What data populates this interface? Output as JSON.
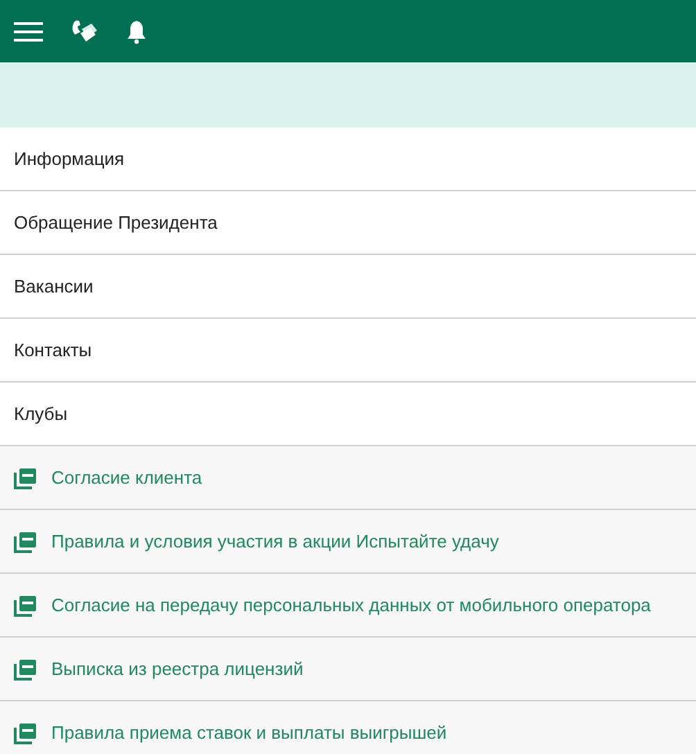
{
  "menu": [
    {
      "kind": "link",
      "label": "Информация"
    },
    {
      "kind": "link",
      "label": "Обращение Президента"
    },
    {
      "kind": "link",
      "label": "Вакансии"
    },
    {
      "kind": "link",
      "label": "Контакты"
    },
    {
      "kind": "link",
      "label": "Клубы"
    },
    {
      "kind": "pdf",
      "label": "Согласие клиента"
    },
    {
      "kind": "pdf",
      "label": "Правила и условия участия в акции Испытайте удачу"
    },
    {
      "kind": "pdf",
      "label": "Согласие на передачу персональных данных от мобильного оператора"
    },
    {
      "kind": "pdf",
      "label": "Выписка из реестра лицензий"
    },
    {
      "kind": "pdf",
      "label": "Правила приема ставок и выплаты выигрышей"
    }
  ]
}
